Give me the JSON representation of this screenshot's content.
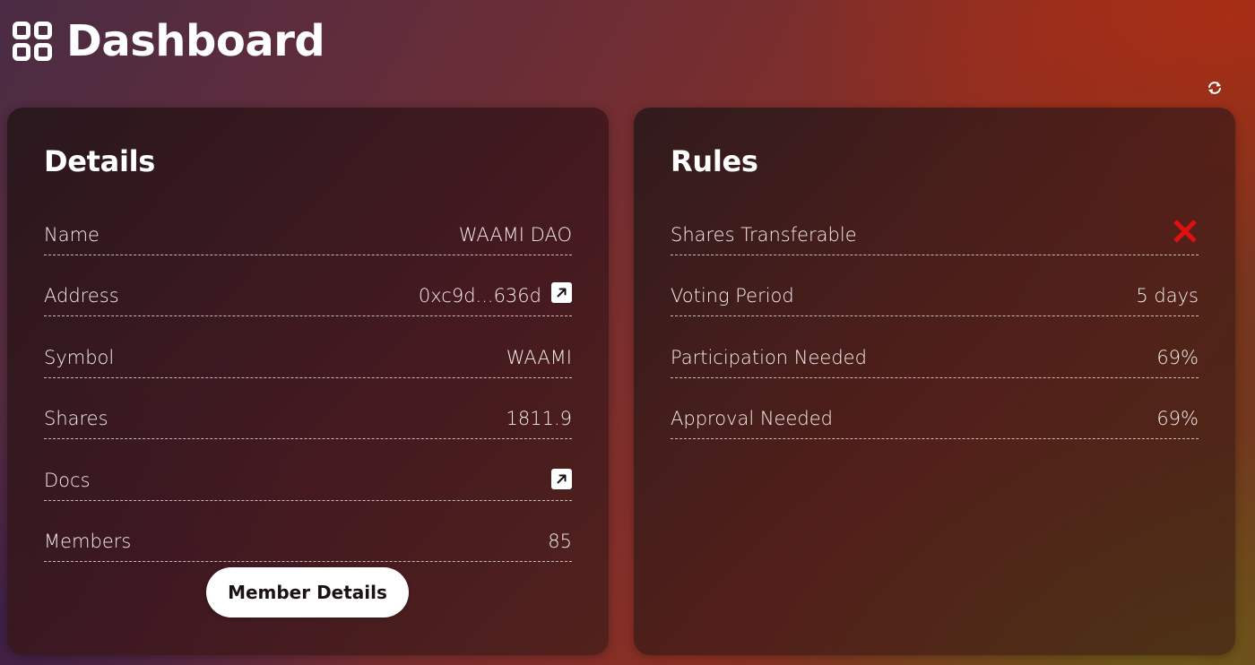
{
  "header": {
    "title": "Dashboard",
    "icon": "dashboard-grid-icon"
  },
  "refresh": {
    "icon": "refresh-icon"
  },
  "details": {
    "title": "Details",
    "rows": [
      {
        "label": "Name",
        "value": "WAAMI DAO"
      },
      {
        "label": "Address",
        "value": "0xc9d...636d",
        "icon": "external-link-icon"
      },
      {
        "label": "Symbol",
        "value": "WAAMI"
      },
      {
        "label": "Shares",
        "value": "1811.9"
      },
      {
        "label": "Docs",
        "value": "",
        "icon": "external-link-icon"
      },
      {
        "label": "Members",
        "value": "85"
      }
    ],
    "button_label": "Member Details"
  },
  "rules": {
    "title": "Rules",
    "rows": [
      {
        "label": "Shares Transferable",
        "value": "",
        "icon": "close-x-icon",
        "icon_color": "#e01010"
      },
      {
        "label": "Voting Period",
        "value": "5 days"
      },
      {
        "label": "Participation Needed",
        "value": "69%"
      },
      {
        "label": "Approval Needed",
        "value": "69%"
      }
    ]
  }
}
